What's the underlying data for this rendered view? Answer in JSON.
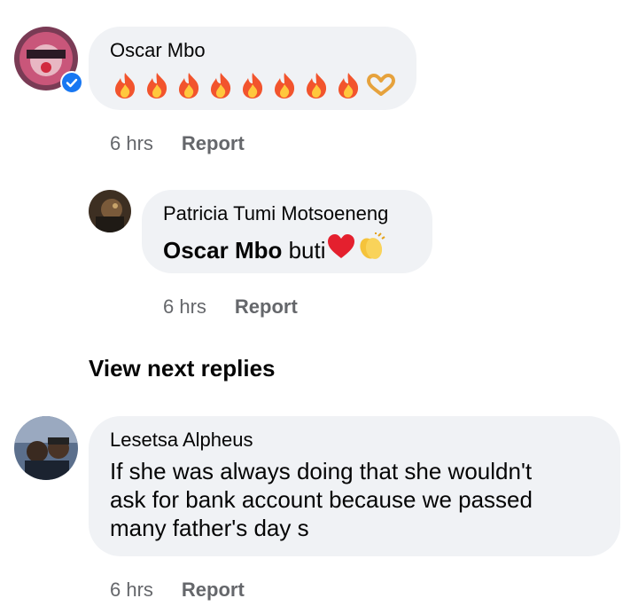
{
  "comments": [
    {
      "author": "Oscar Mbo",
      "emoji": [
        "fire-emoji",
        "fire-emoji",
        "fire-emoji",
        "fire-emoji",
        "fire-emoji",
        "fire-emoji",
        "fire-emoji",
        "fire-emoji",
        "heart-hands-emoji"
      ],
      "time": "6 hrs",
      "action": "Report",
      "verified": true
    },
    {
      "author": "Patricia Tumi Motsoeneng",
      "mention": "Oscar Mbo",
      "text": " buti",
      "emoji": [
        "red-heart-emoji",
        "clapping-hands-emoji"
      ],
      "time": "6 hrs",
      "action": "Report"
    },
    {
      "author": "Lesetsa Alpheus",
      "text_lines": [
        "If she was always doing that she wouldn't",
        "ask for bank account because we passed",
        "many father's day s"
      ],
      "time": "6 hrs",
      "action": "Report"
    }
  ],
  "view_next_replies": "View next replies",
  "colors": {
    "bubble": "#f0f2f5",
    "meta": "#65676b",
    "verified": "#1877f2",
    "text": "#050505"
  }
}
